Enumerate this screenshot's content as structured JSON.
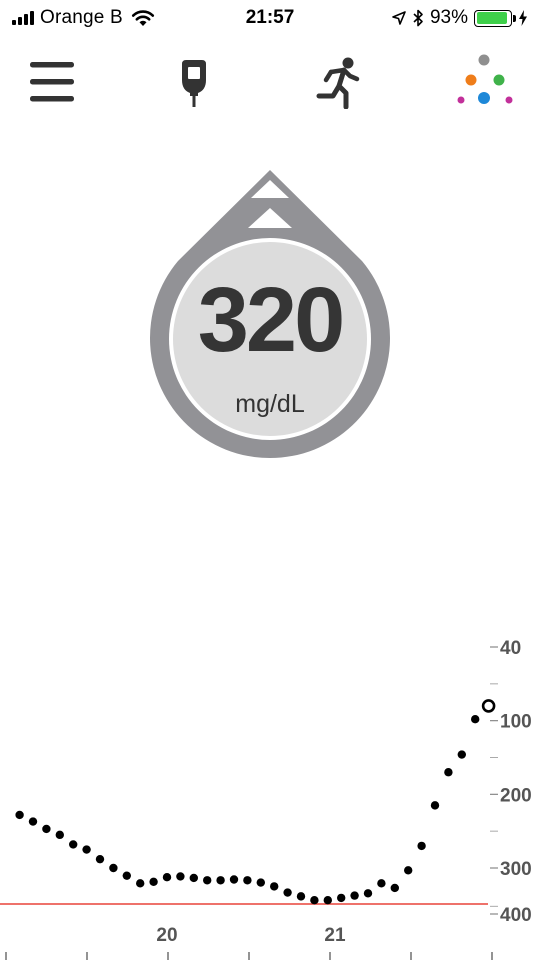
{
  "status_bar": {
    "carrier": "Orange B",
    "time": "21:57",
    "battery_percent": "93%",
    "battery_level": 0.93,
    "icons": [
      "signal-icon",
      "wifi-icon",
      "location-arrow-icon",
      "bluetooth-icon",
      "battery-icon",
      "charging-bolt-icon"
    ]
  },
  "toolbar": {
    "items": [
      "menu-icon",
      "glucose-meter-icon",
      "running-person-icon",
      "colored-dots-icon"
    ],
    "colors": {
      "gray": "#8f8f8f",
      "orange": "#ef7d1a",
      "green": "#3fb24a",
      "blue": "#1e88d8",
      "magenta": "#c2309a"
    }
  },
  "glucose": {
    "value": "320",
    "unit": "mg/dL",
    "trend": "rising-fast",
    "trend_icon": "double-up-arrow-icon",
    "colors": {
      "ring": "#929296",
      "face": "#dcdcdc",
      "text": "#353535"
    }
  },
  "chart_data": {
    "type": "scatter",
    "title": "",
    "xlabel": "",
    "ylabel": "",
    "x_tick_labels": [
      "20",
      "21"
    ],
    "y_tick_labels": [
      "400",
      "300",
      "200",
      "100",
      "40"
    ],
    "y_ticks": [
      40,
      100,
      200,
      300,
      400
    ],
    "y_minor_ticks": [
      50,
      150,
      250,
      350
    ],
    "ylim": [
      25,
      420
    ],
    "xlim": [
      19.1,
      21.95
    ],
    "threset_line_value": 70,
    "threshold_line_color": "#e8443a",
    "series": [
      {
        "x": [
          19.12,
          19.2,
          19.28,
          19.36,
          19.44,
          19.52,
          19.6,
          19.68,
          19.76,
          19.84,
          19.92,
          20.0,
          20.08,
          20.16,
          20.24,
          20.32,
          20.4,
          20.48,
          20.56,
          20.64,
          20.72,
          20.8,
          20.88,
          20.96,
          21.04,
          21.12,
          21.2,
          21.28,
          21.36,
          21.44,
          21.52,
          21.6,
          21.68,
          21.76,
          21.84
        ],
        "y": [
          172,
          163,
          153,
          145,
          132,
          125,
          112,
          100,
          90,
          80,
          82,
          88,
          89,
          87,
          84,
          84,
          85,
          84,
          81,
          76,
          68,
          63,
          58,
          58,
          61,
          64,
          67,
          80,
          74,
          97,
          130,
          185,
          230,
          254,
          302
        ]
      }
    ],
    "latest_point": {
      "x": 21.92,
      "y": 320
    }
  }
}
